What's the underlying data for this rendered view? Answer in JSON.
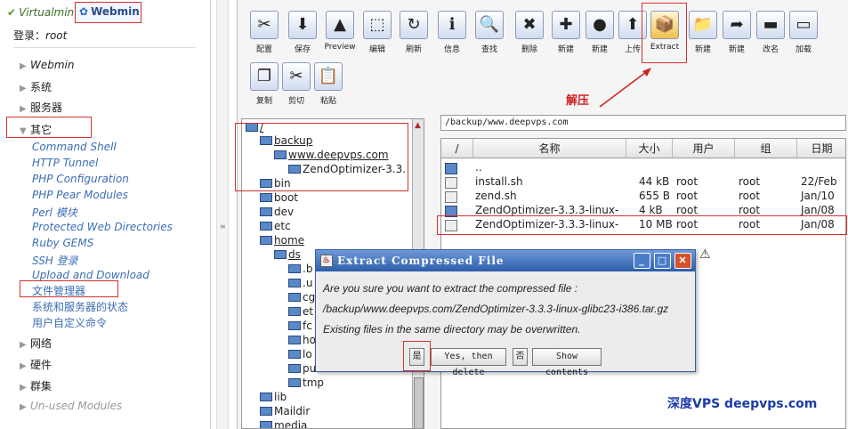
{
  "sidebar": {
    "tab_virtualmin": "Virtualmin",
    "tab_webmin": "Webmin",
    "login_label": "登录：",
    "login_user": "root",
    "categories": [
      "Webmin",
      "系统",
      "服务器",
      "其它",
      "网络",
      "硬件",
      "群集",
      "Un-used Modules"
    ],
    "others_items": [
      "Command Shell",
      "HTTP Tunnel",
      "PHP Configuration",
      "PHP Pear Modules",
      "Perl 模块",
      "Protected Web Directories",
      "Ruby GEMS",
      "SSH 登录",
      "Upload and Download",
      "文件管理器",
      "系统和服务器的状态",
      "用户自定义命令"
    ]
  },
  "toolbar": {
    "buttons": [
      "配置",
      "保存",
      "Preview",
      "编辑",
      "刷新",
      "信息",
      "查找",
      "删除",
      "新建",
      "新建",
      "上传",
      "Extract",
      "新建",
      "新建",
      "改名",
      "加载"
    ],
    "buttons_row2": [
      "复制",
      "剪切",
      "粘贴"
    ],
    "icons": [
      "tools-icon",
      "save-icon",
      "preview-icon",
      "edit-icon",
      "refresh-icon",
      "info-icon",
      "search-icon",
      "delete-icon",
      "new-file-icon",
      "firefox-icon",
      "upload-icon",
      "extract-box-icon",
      "new-folder-icon",
      "new-link-icon",
      "rename-icon",
      "mount-icon",
      "copy-icon",
      "cut-icon",
      "paste-icon"
    ]
  },
  "path": "/backup/www.deepvps.com",
  "tree": {
    "root": "/",
    "items": [
      "backup",
      "www.deepvps.com",
      "ZendOptimizer-3.3.",
      "bin",
      "boot",
      "dev",
      "etc",
      "home",
      "ds",
      ".b",
      ".u",
      "cg",
      "et",
      "fc",
      "ho",
      "lo",
      "pu",
      "tmp",
      "lib",
      "Maildir",
      "media"
    ]
  },
  "files": {
    "columns": [
      "/",
      "名称",
      "大小",
      "用户",
      "组",
      "日期"
    ],
    "rows": [
      {
        "name": "..",
        "size": "",
        "user": "",
        "group": "",
        "date": ""
      },
      {
        "name": "install.sh",
        "size": "44 kB",
        "user": "root",
        "group": "root",
        "date": "22/Feb"
      },
      {
        "name": "zend.sh",
        "size": "655 B",
        "user": "root",
        "group": "root",
        "date": "Jan/10"
      },
      {
        "name": "ZendOptimizer-3.3.3-linux-",
        "size": "4 kB",
        "user": "root",
        "group": "root",
        "date": "Jan/08"
      },
      {
        "name": "ZendOptimizer-3.3.3-linux-",
        "size": "10 MB",
        "user": "root",
        "group": "root",
        "date": "Jan/08"
      }
    ]
  },
  "dialog": {
    "title": "Extract Compressed File",
    "line1": "Are you sure you want to extract the compressed file :",
    "line2": "/backup/www.deepvps.com/ZendOptimizer-3.3.3-linux-glibc23-i386.tar.gz",
    "line3": "Existing files in the same directory may be overwritten.",
    "btn_yes": "是",
    "btn_yes_delete": "Yes, then delete",
    "btn_no": "否",
    "btn_show": "Show contents"
  },
  "annotation": "解压",
  "watermark": "深度VPS deepvps.com"
}
